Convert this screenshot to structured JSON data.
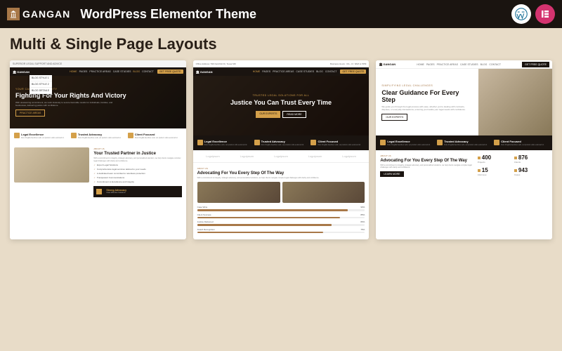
{
  "header": {
    "brand": "GANGAN",
    "title": "WordPress Elementor Theme"
  },
  "subtitle": "Multi & Single Page Layouts",
  "nav": {
    "items": [
      "HOME",
      "PAGES",
      "PRACTICE AREAS",
      "CASE STUDIES",
      "BLOG",
      "CONTACT"
    ],
    "cta": "GET FREE QUOTE"
  },
  "dropdown": [
    "BLOG STYLE 1",
    "BLOG STYLE 2",
    "BLOG DETAILS"
  ],
  "card1": {
    "topbar": "SUPERIOR LEGAL SUPPORT AND ADVICE",
    "hero": {
      "tag": "YOUR CASE, OUR PRIORITY",
      "title": "Fighting For Your Rights And Victory",
      "sub": "With unwavering commitment, we work tirelessly to secure favorable results for individuals, families, and businesses, delivering justice with confidence.",
      "btn": "PRACTICE AREAS"
    },
    "features": [
      {
        "t": "Legal Excellence",
        "d": "Duis fringilla faucibus velit, vel pretium odio euismod id."
      },
      {
        "t": "Trusted Advocacy",
        "d": "Duis fringilla faucibus velit, vel pretium odio euismod id."
      },
      {
        "t": "Client Focused",
        "d": "Duis fringilla faucibus velit, vel pretium odio euismod id."
      }
    ],
    "section": {
      "tag": "ABOUT US",
      "title": "Your Trusted Partner in Justice",
      "desc": "With a commitment to integrity, strategic advocacy, and personalized attention, we help clients navigate complex legal challenges with clarity and confidence.",
      "checks": [
        "Expert Legal Solutions",
        "Comprehensive legal services tailored to your needs",
        "A dedicated team committed to relentless protection",
        "Transparent Communications",
        "Commitment to Excellence and Integrity",
        "Clear Effective Solutions"
      ]
    },
    "box": [
      {
        "t": "Strong Advocacy",
        "d": "Clear Effective Solutions"
      }
    ]
  },
  "card2": {
    "topbar_left": "Office Address: 539 Fairchild Dr, Texas MD",
    "topbar_right": "Business Hours : Mo - Fr: 8AM to 5PM",
    "hero": {
      "tag": "TRUSTED LEGAL SOLUTIONS FOR ALL",
      "title": "Justice You Can Trust Every Time",
      "btn1": "OUR EXPERTS",
      "btn2": "READ MORE"
    },
    "features": [
      {
        "t": "Legal Excellence",
        "d": "Duis fringilla faucibus velit, vel pretium odio euismod id."
      },
      {
        "t": "Trusted Advocacy",
        "d": "Duis fringilla faucibus velit, vel pretium odio euismod id."
      },
      {
        "t": "Client Focused",
        "d": "Duis fringilla faucibus velit, vel pretium odio euismod id."
      }
    ],
    "logos": [
      "Logoipsum",
      "Logoipsum",
      "Logoipsum",
      "Logoipsum",
      "Logoipsum"
    ],
    "section": {
      "tag": "ABOUT US",
      "title": "Advocating For You Every Step Of The Way",
      "desc": "With a commitment to integrity, strategic advocacy, and personalized solutions, we help clients navigate complex legal challenges with clarity and confidence."
    },
    "progress": [
      {
        "l": "Case Wins",
        "v": 90
      },
      {
        "l": "Client Success",
        "v": 85
      },
      {
        "l": "Justice Delivered",
        "v": 80
      },
      {
        "l": "Award Recognition",
        "v": 75
      }
    ]
  },
  "card3": {
    "cta": "GET FREE QUOTE",
    "hero": {
      "tag": "SIMPLIFYING LEGAL CHALLENGES",
      "title": "Clear Guidance For Every Step",
      "sub": "We guide you through the legal process with ease, whether you're dealing with contracts, disputes, or everyday transactions, ensuring you handle your legal needs with confidence.",
      "btn": "OUR EXPERTS"
    },
    "features": [
      {
        "t": "Legal Excellence",
        "d": "Duis fringilla faucibus velit, vel pretium odio euismod id."
      },
      {
        "t": "Trusted Advocacy",
        "d": "Duis fringilla faucibus velit, vel pretium odio euismod id."
      },
      {
        "t": "Client Focused",
        "d": "Duis fringilla faucibus velit, vel pretium odio euismod id."
      }
    ],
    "section": {
      "tag": "ABOUT US",
      "title": "Advocating For You Every Step Of The Way",
      "desc": "With a commitment to integrity, strategic advocacy, and personalized solutions, we help clients navigate complex legal challenges with clarity and confidence.",
      "btn": "LEARN MORE"
    },
    "stats": [
      {
        "n": "400",
        "l": "Projects"
      },
      {
        "n": "876",
        "l": "Clients"
      },
      {
        "n": "15",
        "l": "Attorneys"
      },
      {
        "n": "943",
        "l": "Cases"
      }
    ]
  }
}
